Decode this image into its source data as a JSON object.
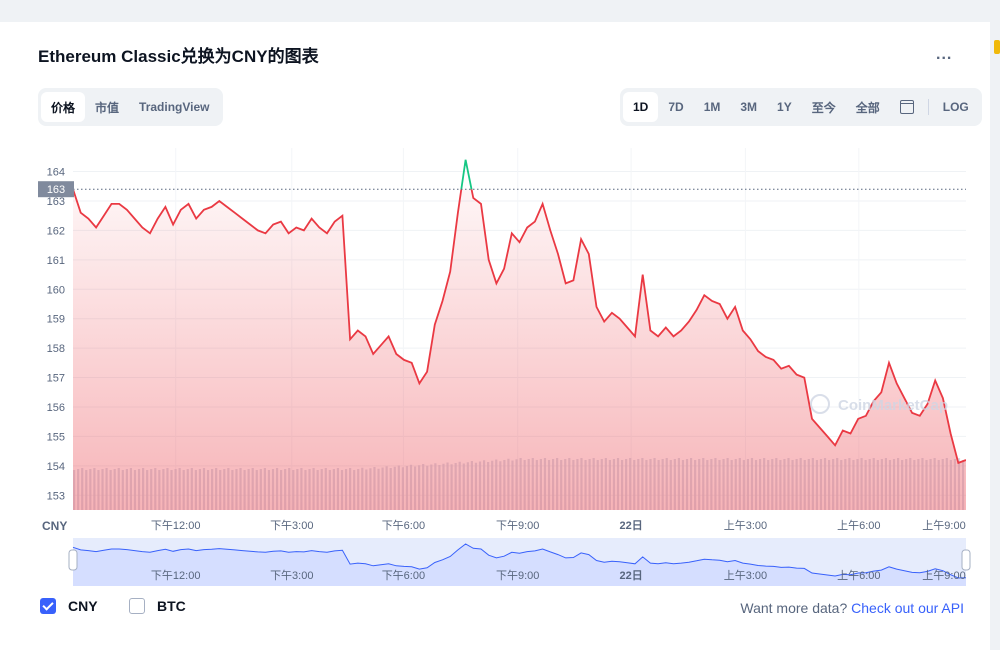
{
  "title": "Ethereum Classic兑换为CNY的图表",
  "more_label": "...",
  "view_tabs": [
    "价格",
    "市值",
    "TradingView"
  ],
  "range_tabs": [
    "1D",
    "7D",
    "1M",
    "3M",
    "1Y",
    "至今",
    "全部"
  ],
  "log_label": "LOG",
  "watermark": "CoinMarketCap",
  "axis_unit": "CNY",
  "legend": {
    "cny": "CNY",
    "btc": "BTC"
  },
  "more_data": {
    "text": "Want more data?",
    "link": "Check out our API"
  },
  "colors": {
    "up": "#16c784",
    "down": "#ea3943",
    "accent": "#3861fb"
  },
  "chart_data": {
    "type": "line",
    "ylim": [
      152.5,
      164.8
    ],
    "yticks": [
      153,
      154,
      155,
      156,
      157,
      158,
      159,
      160,
      161,
      162,
      163,
      164
    ],
    "reference_value": 163.4,
    "reference_label": "163",
    "xticks": [
      {
        "label": "下午12:00",
        "t": 0.115
      },
      {
        "label": "下午3:00",
        "t": 0.245
      },
      {
        "label": "下午6:00",
        "t": 0.37
      },
      {
        "label": "下午9:00",
        "t": 0.498
      },
      {
        "label": "22日",
        "t": 0.625
      },
      {
        "label": "上午3:00",
        "t": 0.753
      },
      {
        "label": "上午6:00",
        "t": 0.88
      },
      {
        "label": "上午9:00",
        "t": 1.007
      }
    ],
    "grid": true,
    "series": [
      {
        "values": [
          163.4,
          162.6,
          162.4,
          162.1,
          162.5,
          162.9,
          162.9,
          162.7,
          162.4,
          162.1,
          161.9,
          162.4,
          162.8,
          162.2,
          162.7,
          162.9,
          162.4,
          162.7,
          162.8,
          163.0,
          162.8,
          162.6,
          162.4,
          162.2,
          162.0,
          161.9,
          162.2,
          162.3,
          161.9,
          162.1,
          162.0,
          162.4,
          162.1,
          161.9,
          162.3,
          162.5,
          158.3,
          158.6,
          158.4,
          157.8,
          158.1,
          158.4,
          157.8,
          157.6,
          157.5,
          156.8,
          157.2,
          158.8,
          159.6,
          160.6,
          162.6,
          164.4,
          163.1,
          162.9,
          161.0,
          160.2,
          160.7,
          161.9,
          161.6,
          162.1,
          162.3,
          162.9,
          162.0,
          161.2,
          160.2,
          160.3,
          161.7,
          161.2,
          159.4,
          158.9,
          159.2,
          159.0,
          158.7,
          158.4,
          160.5,
          158.6,
          158.4,
          158.7,
          158.4,
          158.6,
          158.9,
          159.3,
          159.8,
          159.6,
          159.5,
          159.0,
          159.4,
          158.6,
          158.3,
          157.9,
          157.7,
          157.6,
          157.3,
          157.4,
          157.1,
          157.0,
          155.6,
          155.3,
          155.0,
          154.7,
          155.2,
          155.1,
          155.6,
          155.7,
          156.2,
          156.5,
          157.5,
          156.8,
          156.3,
          155.8,
          155.7,
          156.1,
          156.9,
          156.3,
          155.1,
          154.1,
          154.2
        ]
      }
    ]
  }
}
